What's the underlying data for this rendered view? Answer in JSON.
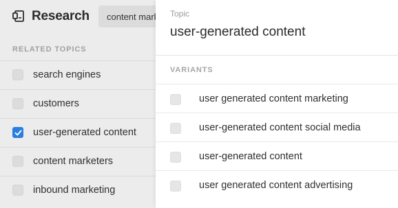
{
  "app": {
    "title": "Research",
    "search_value": "content marketing"
  },
  "related_topics": {
    "heading": "RELATED TOPICS",
    "items": [
      {
        "label": "search engines",
        "checked": false
      },
      {
        "label": "customers",
        "checked": false
      },
      {
        "label": "user-generated content",
        "checked": true
      },
      {
        "label": "content marketers",
        "checked": false
      },
      {
        "label": "inbound marketing",
        "checked": false
      }
    ]
  },
  "panel": {
    "kicker": "Topic",
    "title": "user-generated content",
    "variants_heading": "VARIANTS",
    "variants": [
      {
        "label": "user generated content marketing",
        "checked": false
      },
      {
        "label": "user-generated content social media",
        "checked": false
      },
      {
        "label": "user-generated content",
        "checked": false
      },
      {
        "label": "user generated content advertising",
        "checked": false
      }
    ]
  },
  "colors": {
    "accent": "#2a7de1",
    "sidebar_bg": "#ececec",
    "panel_bg": "#ffffff"
  }
}
